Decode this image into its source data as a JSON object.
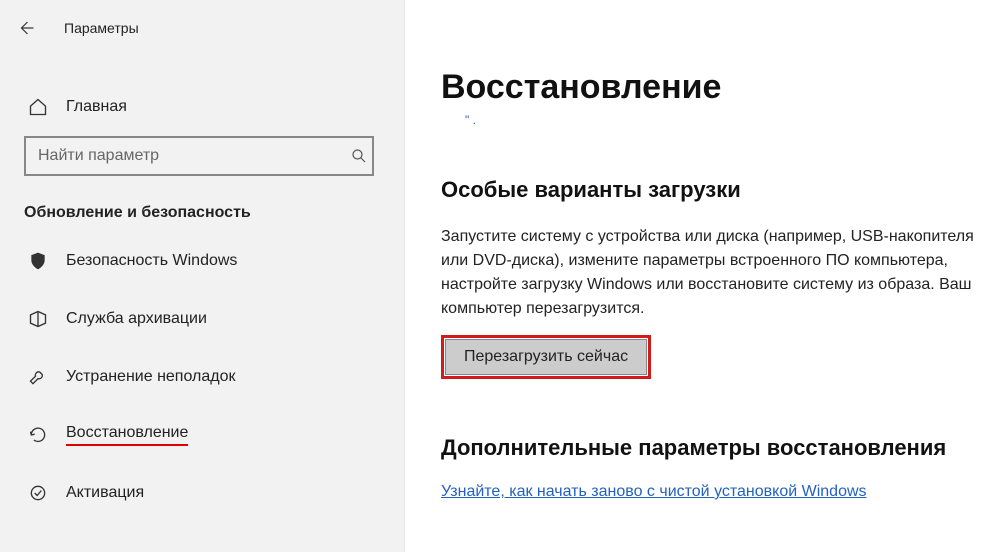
{
  "header": {
    "title": "Параметры"
  },
  "sidebar": {
    "home_label": "Главная",
    "search_placeholder": "Найти параметр",
    "category_title": "Обновление и безопасность",
    "items": [
      {
        "label": "Безопасность Windows"
      },
      {
        "label": "Служба архивации"
      },
      {
        "label": "Устранение неполадок"
      },
      {
        "label": "Восстановление"
      },
      {
        "label": "Активация"
      }
    ]
  },
  "main": {
    "page_title": "Восстановление",
    "section1_title": "Особые варианты загрузки",
    "section1_text": "Запустите систему с устройства или диска (например, USB-накопителя или DVD-диска), измените параметры встроенного ПО компьютера, настройте загрузку Windows или восстановите систему из образа. Ваш компьютер перезагрузится.",
    "restart_button": "Перезагрузить сейчас",
    "section2_title": "Дополнительные параметры восстановления",
    "section2_link": "Узнайте, как начать заново с чистой установкой Windows"
  }
}
